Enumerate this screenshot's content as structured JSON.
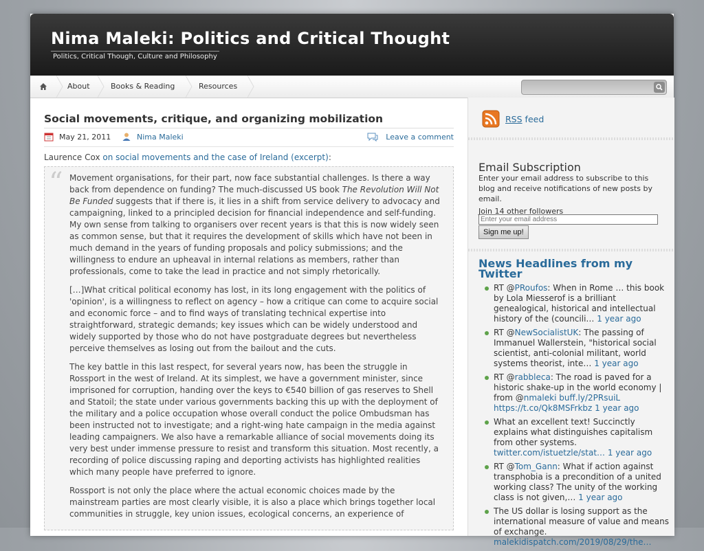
{
  "header": {
    "title": "Nima Maleki: Politics and Critical Thought",
    "subtitle": "Politics, Critical Though, Culture and Philosophy"
  },
  "nav": {
    "items": [
      "About",
      "Books & Reading",
      "Resources"
    ]
  },
  "post": {
    "title": "Social movements, critique, and organizing mobilization",
    "date": "May 21, 2011",
    "author": "Nima Maleki",
    "comment": "Leave a comment",
    "intro_author": "Laurence Cox",
    "intro_link": "on social movements and the case of Ireland (excerpt)",
    "intro_end": ":",
    "p1a": "Movement organisations, for their part, now face substantial challenges. Is there a way back from dependence on funding? The much-discussed US book ",
    "p1_book": "The Revolution Will Not Be Funded",
    "p1b": " suggests that if there is, it lies in a shift from service delivery to advocacy and campaigning, linked to a principled decision for financial independence and self-funding. My own sense from talking to organisers over recent years is that this is now widely seen as common sense, but that it requires the development of skills which have not been in much demand in the years of funding proposals and policy submissions; and the willingness to endure an upheaval in internal relations as members, rather than professionals, come to take the lead in practice and not simply rhetorically.",
    "p2": "[…]What critical political economy has lost, in its long engagement with the politics of 'opinion', is a willingness to reflect on agency – how a critique can come to acquire social and economic force – and to find ways of translating technical expertise into straightforward, strategic demands; key issues which can be widely understood and widely supported by those who do not have postgraduate degrees but nevertheless perceive themselves as losing out from the bailout and the cuts.",
    "p3": "The key battle in this last respect, for several years now, has been the struggle in Rossport in the west of Ireland. At its simplest, we have a government minister, since imprisoned for corruption, handing over the keys to €540 billion of gas reserves to Shell and Statoil; the state under various governments backing this up with the deployment of the military and a police occupation whose overall conduct the police Ombudsman has been instructed not to investigate; and a right-wing hate campaign in the media against leading campaigners. We also have a remarkable alliance of social movements doing its very best under immense pressure to resist and transform this situation. Most recently, a recording of police discussing raping and deporting activists has highlighted realities which many people have preferred to ignore.",
    "p4": "Rossport is not only the place where the actual economic choices made by the mainstream parties are most clearly visible, it is also a place which brings together local communities in struggle, key union issues, ecological concerns, an experience of"
  },
  "sidebar": {
    "rss_label": "RSS feed",
    "email_title": "Email Subscription",
    "email_text": "Enter your email address to subscribe to this blog and receive notifications of new posts by email.",
    "followers": "Join 14 other followers",
    "email_placeholder": "Enter your email address",
    "signup": "Sign me up!",
    "news_title": "News Headlines from my Twitter",
    "tweets": [
      {
        "pre": "RT @",
        "handle": "PRoufos",
        "text": ": When in Rome … this book by Lola Miesserof is a brilliant genealogical, historical and intellectual history of the (councili…",
        "time": "1 year ago"
      },
      {
        "pre": "RT @",
        "handle": "NewSocialistUK",
        "text": ": The passing of Immanuel Wallerstein, \"historical social scientist, anti-colonial militant, world systems theorist, inte…",
        "time": "1 year ago"
      },
      {
        "pre": "RT @",
        "handle": "rabbleca",
        "text": ": The road is paved for a historic shake-up in the world economy | from @",
        "link2": "nmaleki",
        "link3": " buff.ly/2PRsuiL https://t.co/Qk8MSFrkbz",
        "time": "1 year ago"
      },
      {
        "pre": "",
        "handle": "",
        "text": "What an excellent text! Succinctly explains what distinguishes capitalism from other systems. ",
        "link3": "twitter.com/istuetzle/stat…",
        "time": "1 year ago"
      },
      {
        "pre": "RT @",
        "handle": "Tom_Gann",
        "text": ": What if action against transphobia is a precondition of a united working class? The unity of the working class is not given,…",
        "time": "1 year ago"
      },
      {
        "pre": "",
        "handle": "",
        "text": "The US dollar is losing support as the international measure of value and means of exchange. ",
        "link3": "malekidispatch.com/2019/08/29/the…",
        "time": ""
      }
    ]
  },
  "colors": {
    "link": "#2a6b9a",
    "header_bg": "#222222",
    "bullet": "#5ea24a"
  }
}
